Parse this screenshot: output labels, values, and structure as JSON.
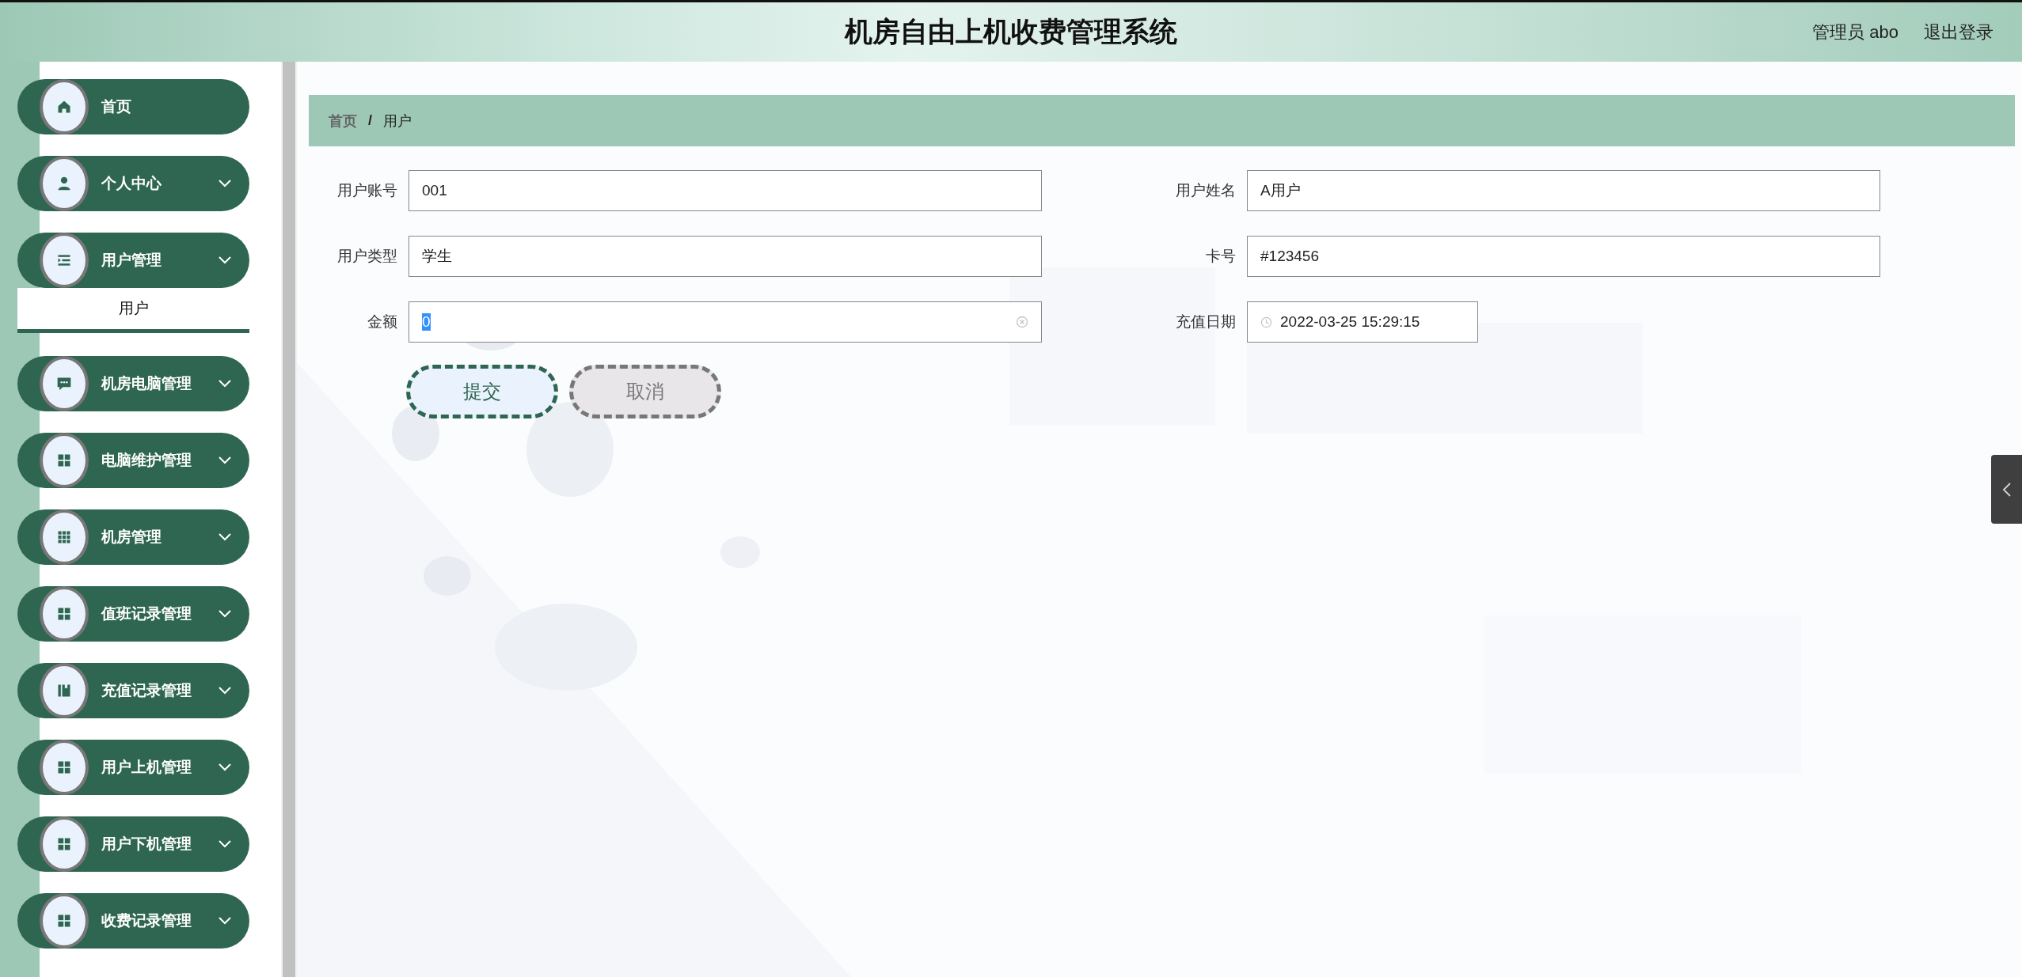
{
  "header": {
    "title": "机房自由上机收费管理系统",
    "user": "管理员 abo",
    "logout": "退出登录"
  },
  "sidebar": {
    "items": [
      {
        "label": "首页",
        "has_submenu": false
      },
      {
        "label": "个人中心",
        "has_submenu": true
      },
      {
        "label": "用户管理",
        "has_submenu": true,
        "children": [
          {
            "label": "用户",
            "selected": true
          }
        ]
      },
      {
        "label": "机房电脑管理",
        "has_submenu": true
      },
      {
        "label": "电脑维护管理",
        "has_submenu": true
      },
      {
        "label": "机房管理",
        "has_submenu": true
      },
      {
        "label": "值班记录管理",
        "has_submenu": true
      },
      {
        "label": "充值记录管理",
        "has_submenu": true
      },
      {
        "label": "用户上机管理",
        "has_submenu": true
      },
      {
        "label": "用户下机管理",
        "has_submenu": true
      },
      {
        "label": "收费记录管理",
        "has_submenu": true
      }
    ]
  },
  "breadcrumb_separator": "/",
  "breadcrumb": [
    {
      "label": "首页",
      "current": false
    },
    {
      "label": "用户",
      "current": true
    }
  ],
  "form": {
    "fields": [
      {
        "label": "用户账号",
        "value": "001",
        "kind": "text"
      },
      {
        "label": "用户姓名",
        "value": "A用户",
        "kind": "text"
      },
      {
        "label": "用户类型",
        "value": "学生",
        "kind": "text"
      },
      {
        "label": "卡号",
        "value": "#123456",
        "kind": "text"
      },
      {
        "label": "金额",
        "value": "0",
        "kind": "number",
        "text_selected": true
      },
      {
        "label": "充值日期",
        "value": "2022-03-25 15:29:15",
        "kind": "datetime"
      }
    ],
    "buttons": [
      {
        "label": "提交",
        "kind": "primary"
      },
      {
        "label": "取消",
        "kind": "secondary"
      }
    ]
  }
}
